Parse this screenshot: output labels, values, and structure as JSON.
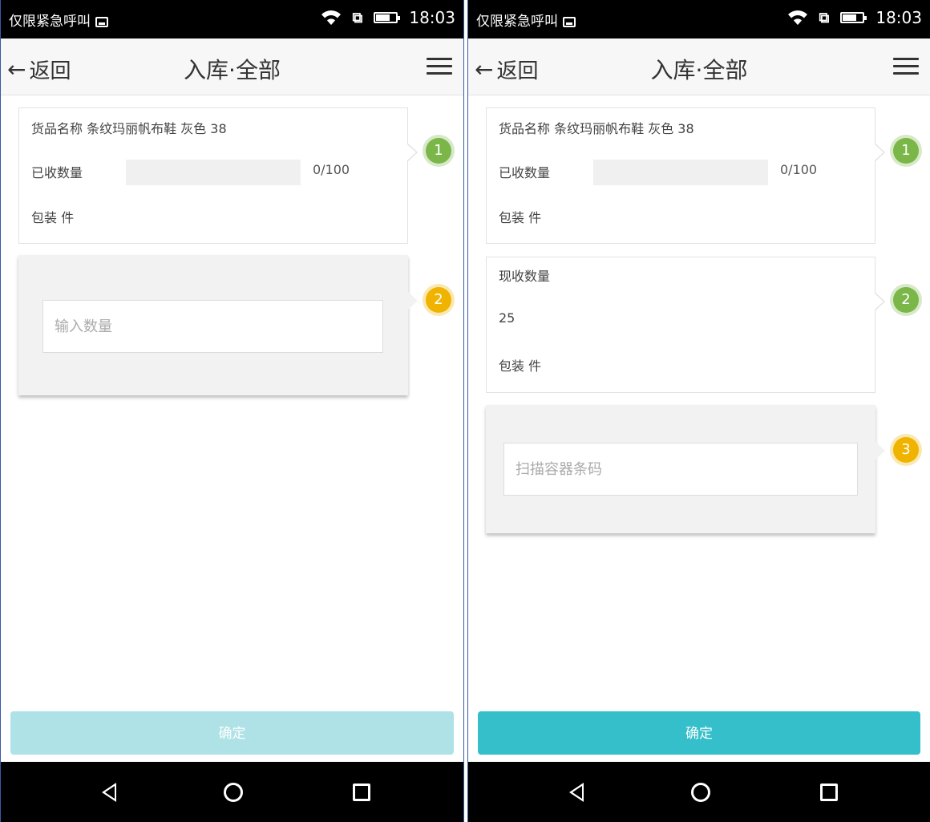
{
  "status": {
    "carrier": "仅限紧急呼叫",
    "time": "18:03"
  },
  "nav": {
    "back": "返回",
    "title": "入库·全部"
  },
  "product_card": {
    "name_label": "货品名称",
    "name_value": "条纹玛丽帆布鞋 灰色 38",
    "received_label": "已收数量",
    "received_ratio": "0/100",
    "packaging": "包装 件"
  },
  "current_card": {
    "label": "现收数量",
    "value": "25",
    "packaging": "包装 件"
  },
  "inputs": {
    "quantity_placeholder": "输入数量",
    "container_placeholder": "扫描容器条码"
  },
  "steps": [
    "1",
    "2",
    "3"
  ],
  "confirm": "确定",
  "colors": {
    "accent": "#34bfca",
    "accent_disabled": "#aee2e6",
    "step_green": "#7ab648",
    "step_yellow": "#f0b400"
  }
}
